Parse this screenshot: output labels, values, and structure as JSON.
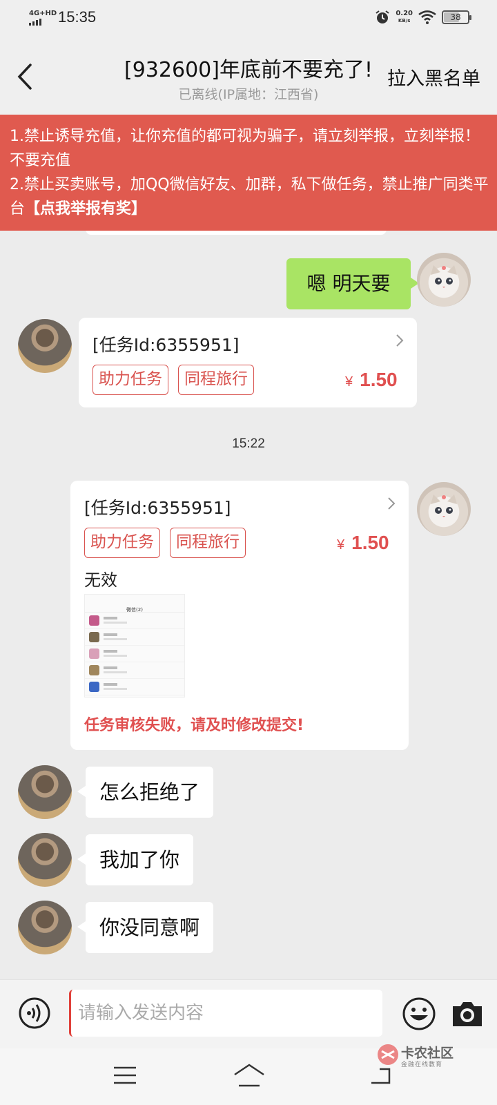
{
  "status_bar": {
    "network": "4G+HD",
    "time": "15:35",
    "speed_value": "0.20",
    "speed_unit": "KB/s",
    "battery": "38",
    "icons": [
      "signal-icon",
      "alarm-icon",
      "wifi-icon",
      "battery-icon"
    ]
  },
  "header": {
    "title": "[932600]年底前不要充了!",
    "subtitle": "已离线(IP属地：江西省)",
    "blacklist_label": "拉入黑名单"
  },
  "banner": {
    "line1": "1.禁止诱导充值，让你充值的都可视为骗子，请立刻举报，立刻举报！不要充值",
    "line2": "2.禁止买卖账号，加QQ微信好友、加群，私下做任务，禁止推广同类平台",
    "report_link": "【点我举报有奖】"
  },
  "chat": {
    "messages": [
      {
        "from": "me",
        "text": "嗯 明天要"
      },
      {
        "from": "other",
        "task_id": "[任务Id:6355951]",
        "tags": [
          "助力任务",
          "同程旅行"
        ],
        "currency": "¥",
        "price": "1.50"
      },
      {
        "timestamp": "15:22"
      },
      {
        "from": "me",
        "task_id": "[任务Id:6355951]",
        "tags": [
          "助力任务",
          "同程旅行"
        ],
        "currency": "¥",
        "price": "1.50",
        "note": "无效",
        "thumbnail_header": "微信(2)",
        "status": "任务审核失败，请及时修改提交!"
      },
      {
        "from": "other",
        "text": "怎么拒绝了"
      },
      {
        "from": "other",
        "text": "我加了你"
      },
      {
        "from": "other",
        "text": "你没同意啊"
      }
    ]
  },
  "input": {
    "placeholder": "请输入发送内容"
  },
  "watermark": {
    "name": "卡农社区",
    "sub": "金融在线教育"
  },
  "colors": {
    "banner": "#e05a4f",
    "accent_red": "#e05050",
    "my_bubble": "#a9e464",
    "background": "#ececec"
  }
}
